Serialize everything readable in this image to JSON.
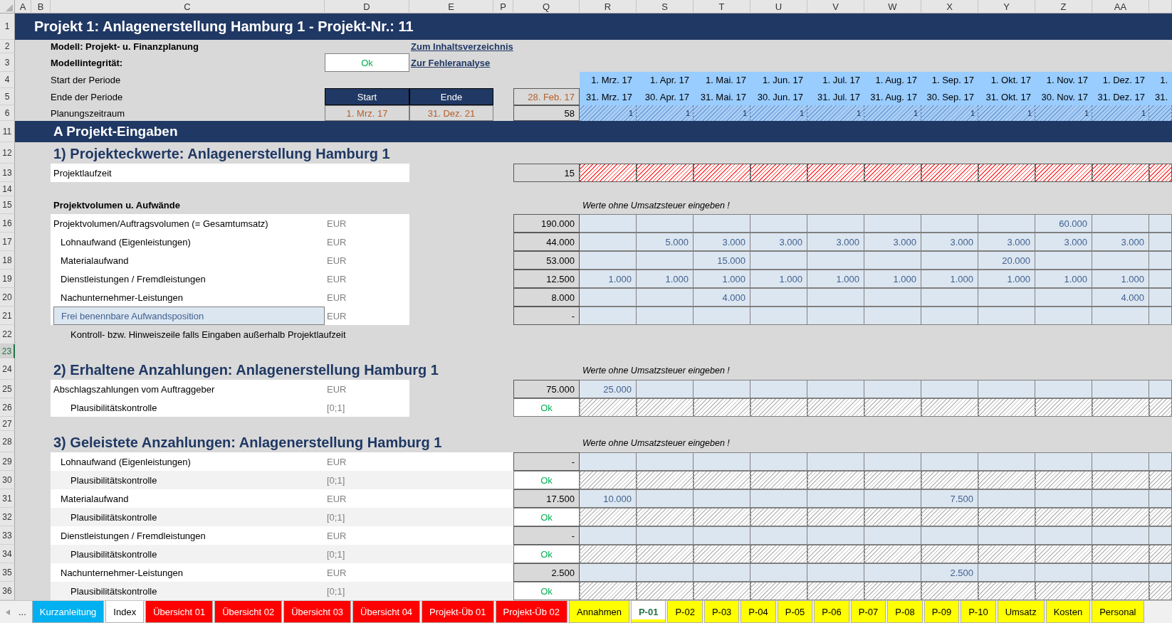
{
  "column_headers": [
    "A",
    "B",
    "C",
    "D",
    "E",
    "P",
    "Q",
    "R",
    "S",
    "T",
    "U",
    "V",
    "W",
    "X",
    "Y",
    "Z",
    "AA"
  ],
  "row_numbers": [
    {
      "label": "1",
      "selected": false
    },
    {
      "label": "2",
      "selected": false
    },
    {
      "label": "3",
      "selected": false
    },
    {
      "label": "4",
      "selected": false
    },
    {
      "label": "5",
      "selected": false
    },
    {
      "label": "6",
      "selected": false
    },
    {
      "label": "11",
      "selected": false
    },
    {
      "label": "12",
      "selected": false
    },
    {
      "label": "13",
      "selected": false
    },
    {
      "label": "14",
      "selected": false
    },
    {
      "label": "15",
      "selected": false
    },
    {
      "label": "16",
      "selected": false
    },
    {
      "label": "17",
      "selected": false
    },
    {
      "label": "18",
      "selected": false
    },
    {
      "label": "19",
      "selected": false
    },
    {
      "label": "20",
      "selected": false
    },
    {
      "label": "21",
      "selected": false
    },
    {
      "label": "22",
      "selected": false
    },
    {
      "label": "23",
      "selected": true
    },
    {
      "label": "24",
      "selected": false
    },
    {
      "label": "25",
      "selected": false
    },
    {
      "label": "26",
      "selected": false
    },
    {
      "label": "27",
      "selected": false
    },
    {
      "label": "28",
      "selected": false
    },
    {
      "label": "29",
      "selected": false
    },
    {
      "label": "30",
      "selected": false
    },
    {
      "label": "31",
      "selected": false
    },
    {
      "label": "32",
      "selected": false
    },
    {
      "label": "33",
      "selected": false
    },
    {
      "label": "34",
      "selected": false
    },
    {
      "label": "35",
      "selected": false
    },
    {
      "label": "36",
      "selected": false
    }
  ],
  "title": "Projekt 1: Anlagenerstellung Hamburg 1 - Projekt-Nr.: 11",
  "model": "Modell: Projekt- u. Finanzplanung",
  "links": [
    "Zum Inhaltsverzeichnis",
    "Zur Fehleranalyse"
  ],
  "integrity": {
    "label": "Modellintegrität:",
    "status": "Ok"
  },
  "period_labels": [
    "Start der Periode",
    "Ende der Periode",
    "Planungszeitraum"
  ],
  "plan": {
    "start_header": "Start",
    "end_header": "Ende",
    "start": "1. Mrz. 17",
    "end": "31. Dez. 21",
    "before": "28. Feb. 17",
    "count": "58"
  },
  "period_starts": [
    "1. Mrz. 17",
    "1. Apr. 17",
    "1. Mai. 17",
    "1. Jun. 17",
    "1. Jul. 17",
    "1. Aug. 17",
    "1. Sep. 17",
    "1. Okt. 17",
    "1. Nov. 17",
    "1. Dez. 17",
    "1."
  ],
  "period_ends": [
    "31. Mrz. 17",
    "30. Apr. 17",
    "31. Mai. 17",
    "30. Jun. 17",
    "31. Jul. 17",
    "31. Aug. 17",
    "30. Sep. 17",
    "31. Okt. 17",
    "30. Nov. 17",
    "31. Dez. 17",
    "31."
  ],
  "period_flags": [
    "1",
    "1",
    "1",
    "1",
    "1",
    "1",
    "1",
    "1",
    "1",
    "1"
  ],
  "section_bar": "A  Projekt-Eingaben",
  "sections": [
    {
      "heading": "1) Projekteckwerte: Anlagenerstellung Hamburg 1",
      "kind": "narrow",
      "rows": [
        {
          "kind": "duration",
          "label": "Projektlaufzeit",
          "total": "15"
        },
        {
          "kind": "blank"
        },
        {
          "kind": "caption",
          "label": "Projektvolumen u. Aufwände",
          "note": "Werte ohne Umsatzsteuer eingeben !"
        },
        {
          "kind": "data",
          "label": "Projektvolumen/Auftragsvolumen (= Gesamtumsatz)",
          "indented": false,
          "unit": "EUR",
          "total": "190.000",
          "cells": [
            {
              "kind": "empty"
            },
            {
              "kind": "empty"
            },
            {
              "kind": "empty"
            },
            {
              "kind": "empty"
            },
            {
              "kind": "empty"
            },
            {
              "kind": "empty"
            },
            {
              "kind": "empty"
            },
            {
              "kind": "empty"
            },
            {
              "kind": "value",
              "value": "60.000"
            },
            {
              "kind": "empty"
            }
          ]
        },
        {
          "kind": "data",
          "label": "Lohnaufwand (Eigenleistungen)",
          "indented": true,
          "unit": "EUR",
          "total": "44.000",
          "cells": [
            {
              "kind": "empty"
            },
            {
              "kind": "value",
              "value": "5.000"
            },
            {
              "kind": "value",
              "value": "3.000"
            },
            {
              "kind": "value",
              "value": "3.000"
            },
            {
              "kind": "value",
              "value": "3.000"
            },
            {
              "kind": "value",
              "value": "3.000"
            },
            {
              "kind": "value",
              "value": "3.000"
            },
            {
              "kind": "value",
              "value": "3.000"
            },
            {
              "kind": "value",
              "value": "3.000"
            },
            {
              "kind": "value",
              "value": "3.000"
            }
          ]
        },
        {
          "kind": "data",
          "label": "Materialaufwand",
          "indented": true,
          "unit": "EUR",
          "total": "53.000",
          "cells": [
            {
              "kind": "empty"
            },
            {
              "kind": "empty"
            },
            {
              "kind": "value",
              "value": "15.000"
            },
            {
              "kind": "empty"
            },
            {
              "kind": "empty"
            },
            {
              "kind": "empty"
            },
            {
              "kind": "empty"
            },
            {
              "kind": "value",
              "value": "20.000"
            },
            {
              "kind": "empty"
            },
            {
              "kind": "empty"
            }
          ]
        },
        {
          "kind": "data",
          "label": "Dienstleistungen / Fremdleistungen",
          "indented": true,
          "unit": "EUR",
          "total": "12.500",
          "cells": [
            {
              "kind": "value",
              "value": "1.000"
            },
            {
              "kind": "value",
              "value": "1.000"
            },
            {
              "kind": "value",
              "value": "1.000"
            },
            {
              "kind": "value",
              "value": "1.000"
            },
            {
              "kind": "value",
              "value": "1.000"
            },
            {
              "kind": "value",
              "value": "1.000"
            },
            {
              "kind": "value",
              "value": "1.000"
            },
            {
              "kind": "value",
              "value": "1.000"
            },
            {
              "kind": "value",
              "value": "1.000"
            },
            {
              "kind": "value",
              "value": "1.000"
            }
          ]
        },
        {
          "kind": "data",
          "label": "Nachunternehmer-Leistungen",
          "indented": true,
          "unit": "EUR",
          "total": "8.000",
          "cells": [
            {
              "kind": "empty"
            },
            {
              "kind": "empty"
            },
            {
              "kind": "value",
              "value": "4.000"
            },
            {
              "kind": "empty"
            },
            {
              "kind": "empty"
            },
            {
              "kind": "empty"
            },
            {
              "kind": "empty"
            },
            {
              "kind": "empty"
            },
            {
              "kind": "empty"
            },
            {
              "kind": "value",
              "value": "4.000"
            }
          ]
        },
        {
          "kind": "input",
          "label": "Frei benennbare Aufwandsposition",
          "indented": true,
          "unit": "EUR",
          "total": "-"
        },
        {
          "kind": "hint",
          "label": "Kontroll- bzw. Hinweiszeile falls Eingaben außerhalb Projektlaufzeit"
        },
        {
          "kind": "blank"
        }
      ]
    },
    {
      "heading": "2) Erhaltene Anzahlungen: Anlagenerstellung Hamburg 1",
      "note": "Werte ohne Umsatzsteuer eingeben !",
      "kind": "narrow",
      "rows": [
        {
          "kind": "data",
          "label": "Abschlagszahlungen vom Auftraggeber",
          "indented": false,
          "unit": "EUR",
          "total": "75.000",
          "cells": [
            {
              "kind": "value",
              "value": "25.000"
            },
            {
              "kind": "empty"
            },
            {
              "kind": "empty"
            },
            {
              "kind": "empty"
            },
            {
              "kind": "empty"
            },
            {
              "kind": "empty"
            },
            {
              "kind": "empty"
            },
            {
              "kind": "empty"
            },
            {
              "kind": "empty"
            },
            {
              "kind": "empty"
            }
          ]
        },
        {
          "kind": "check",
          "label": "Plausibilitätskontrolle",
          "unit": "[0;1]",
          "status": "Ok",
          "shaded": false
        },
        {
          "kind": "blank"
        }
      ]
    },
    {
      "heading": "3) Geleistete Anzahlungen: Anlagenerstellung Hamburg 1",
      "note": "Werte ohne Umsatzsteuer eingeben !",
      "kind": "wide",
      "rows": [
        {
          "kind": "data",
          "label": "Lohnaufwand (Eigenleistungen)",
          "indented": true,
          "unit": "EUR",
          "total": "-"
        },
        {
          "kind": "check",
          "label": "Plausibilitätskontrolle",
          "unit": "[0;1]",
          "status": "Ok",
          "shaded": true
        },
        {
          "kind": "data",
          "label": "Materialaufwand",
          "indented": true,
          "unit": "EUR",
          "total": "17.500",
          "cells": [
            {
              "kind": "value",
              "value": "10.000"
            },
            {
              "kind": "empty"
            },
            {
              "kind": "empty"
            },
            {
              "kind": "empty"
            },
            {
              "kind": "empty"
            },
            {
              "kind": "empty"
            },
            {
              "kind": "value",
              "value": "7.500"
            },
            {
              "kind": "empty"
            },
            {
              "kind": "empty"
            },
            {
              "kind": "empty"
            }
          ]
        },
        {
          "kind": "check",
          "label": "Plausibilitätskontrolle",
          "unit": "[0;1]",
          "status": "Ok",
          "shaded": true
        },
        {
          "kind": "data",
          "label": "Dienstleistungen / Fremdleistungen",
          "indented": true,
          "unit": "EUR",
          "total": "-"
        },
        {
          "kind": "check",
          "label": "Plausibilitätskontrolle",
          "unit": "[0;1]",
          "status": "Ok",
          "shaded": true
        },
        {
          "kind": "data",
          "label": "Nachunternehmer-Leistungen",
          "indented": true,
          "unit": "EUR",
          "total": "2.500",
          "cells": [
            {
              "kind": "empty"
            },
            {
              "kind": "empty"
            },
            {
              "kind": "empty"
            },
            {
              "kind": "empty"
            },
            {
              "kind": "empty"
            },
            {
              "kind": "empty"
            },
            {
              "kind": "value",
              "value": "2.500"
            },
            {
              "kind": "empty"
            },
            {
              "kind": "empty"
            },
            {
              "kind": "empty"
            }
          ]
        },
        {
          "kind": "check",
          "label": "Plausibilitätskontrolle",
          "unit": "[0;1]",
          "status": "Ok",
          "shaded": true
        }
      ]
    }
  ],
  "tabs_more": "...",
  "tabs": [
    {
      "label": "Kurzanleitung",
      "color": "#00b0f0",
      "selected": false
    },
    {
      "label": "Index",
      "color": "#ffffff",
      "selected": false
    },
    {
      "label": "Übersicht 01",
      "color": "#ff0000",
      "selected": false
    },
    {
      "label": "Übersicht 02",
      "color": "#ff0000",
      "selected": false
    },
    {
      "label": "Übersicht 03",
      "color": "#ff0000",
      "selected": false
    },
    {
      "label": "Übersicht 04",
      "color": "#ff0000",
      "selected": false
    },
    {
      "label": "Projekt-Üb 01",
      "color": "#ff0000",
      "selected": false
    },
    {
      "label": "Projekt-Üb 02",
      "color": "#ff0000",
      "selected": false
    },
    {
      "label": "Annahmen",
      "color": "#ffff00",
      "selected": false
    },
    {
      "label": "P-01",
      "color": "#ffff00",
      "selected": true
    },
    {
      "label": "P-02",
      "color": "#ffff00",
      "selected": false
    },
    {
      "label": "P-03",
      "color": "#ffff00",
      "selected": false
    },
    {
      "label": "P-04",
      "color": "#ffff00",
      "selected": false
    },
    {
      "label": "P-05",
      "color": "#ffff00",
      "selected": false
    },
    {
      "label": "P-06",
      "color": "#ffff00",
      "selected": false
    },
    {
      "label": "P-07",
      "color": "#ffff00",
      "selected": false
    },
    {
      "label": "P-08",
      "color": "#ffff00",
      "selected": false
    },
    {
      "label": "P-09",
      "color": "#ffff00",
      "selected": false
    },
    {
      "label": "P-10",
      "color": "#ffff00",
      "selected": false
    },
    {
      "label": "Umsatz",
      "color": "#ffff00",
      "selected": false
    },
    {
      "label": "Kosten",
      "color": "#ffff00",
      "selected": false
    },
    {
      "label": "Personal",
      "color": "#ffff00",
      "selected": false
    }
  ]
}
